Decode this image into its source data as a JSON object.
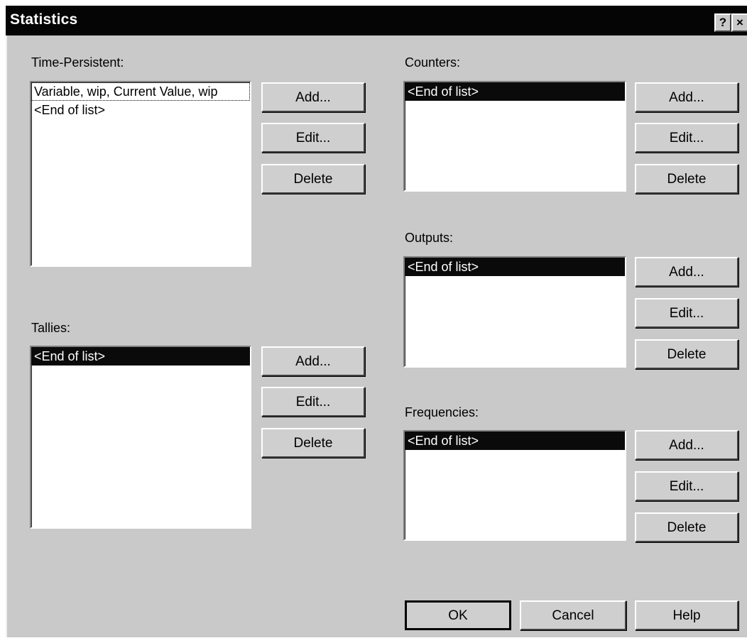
{
  "window": {
    "title": "Statistics",
    "help_glyph": "?",
    "close_glyph": "×"
  },
  "time_persistent": {
    "label": "Time-Persistent:",
    "items": [
      "Variable, wip, Current Value, wip",
      "<End of list>"
    ],
    "add": "Add...",
    "edit": "Edit...",
    "delete": "Delete"
  },
  "tallies": {
    "label": "Tallies:",
    "items": [
      "<End of list>"
    ],
    "add": "Add...",
    "edit": "Edit...",
    "delete": "Delete"
  },
  "counters": {
    "label": "Counters:",
    "items": [
      "<End of list>"
    ],
    "add": "Add...",
    "edit": "Edit...",
    "delete": "Delete"
  },
  "outputs": {
    "label": "Outputs:",
    "items": [
      "<End of list>"
    ],
    "add": "Add...",
    "edit": "Edit...",
    "delete": "Delete"
  },
  "frequencies": {
    "label": "Frequencies:",
    "items": [
      "<End of list>"
    ],
    "add": "Add...",
    "edit": "Edit...",
    "delete": "Delete"
  },
  "footer": {
    "ok": "OK",
    "cancel": "Cancel",
    "help": "Help"
  }
}
